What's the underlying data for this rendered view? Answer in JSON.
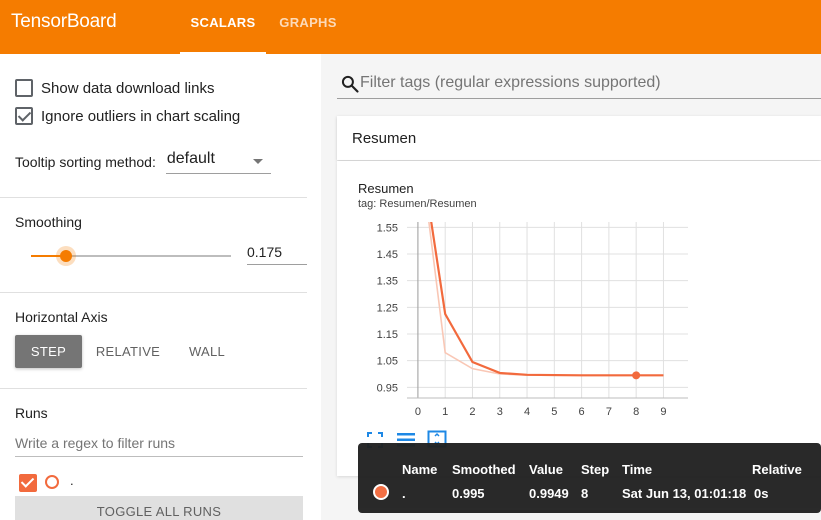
{
  "app": {
    "title": "TensorBoard",
    "accent": "#f57c00",
    "tabs": [
      {
        "label": "SCALARS",
        "active": true
      },
      {
        "label": "GRAPHS",
        "active": false
      }
    ]
  },
  "sidebar": {
    "show_download_links": {
      "label": "Show data download links",
      "checked": false
    },
    "ignore_outliers": {
      "label": "Ignore outliers in chart scaling",
      "checked": true
    },
    "tooltip_sorting": {
      "label": "Tooltip sorting method:",
      "value": "default"
    },
    "smoothing": {
      "title": "Smoothing",
      "value": "0.175",
      "fraction": 0.175
    },
    "horizontal_axis": {
      "title": "Horizontal Axis",
      "options": [
        "STEP",
        "RELATIVE",
        "WALL"
      ],
      "selected": "STEP"
    },
    "runs": {
      "title": "Runs",
      "filter_placeholder": "Write a regex to filter runs",
      "items": [
        {
          "name": ".",
          "checked": true,
          "color": "#f26a3d"
        }
      ],
      "toggle_label": "TOGGLE ALL RUNS"
    }
  },
  "main": {
    "filter_placeholder": "Filter tags (regular expressions supported)",
    "pane_title": "Resumen",
    "card": {
      "title": "Resumen",
      "tag": "tag: Resumen/Resumen"
    },
    "icons": [
      "fullscreen-icon",
      "list-icon",
      "fit-domain-icon",
      "search-icon"
    ]
  },
  "tooltip": {
    "headers": [
      "Name",
      "Smoothed",
      "Value",
      "Step",
      "Time",
      "Relative"
    ],
    "row": {
      "name": ".",
      "smoothed": "0.995",
      "value": "0.9949",
      "step": "8",
      "time": "Sat Jun 13, 01:01:18",
      "relative": "0s",
      "color": "#f26a3d"
    }
  },
  "chart_data": {
    "type": "line",
    "title": "Resumen",
    "x": [
      0,
      1,
      2,
      3,
      4,
      5,
      6,
      7,
      8,
      9
    ],
    "x_ticks": [
      "0",
      "1",
      "2",
      "3",
      "4",
      "5",
      "6",
      "7",
      "8",
      "9"
    ],
    "y_ticks": [
      "0.95",
      "1.05",
      "1.15",
      "1.25",
      "1.35",
      "1.45",
      "1.55"
    ],
    "ylim": [
      0.91,
      1.57
    ],
    "xlim": [
      -0.4,
      9.9
    ],
    "grid": true,
    "series": [
      {
        "name": ".",
        "kind": "raw",
        "color": "#f9c7b5",
        "values": [
          1.9,
          1.08,
          1.02,
          1.0,
          0.996,
          0.995,
          0.995,
          0.995,
          0.995,
          0.995
        ]
      },
      {
        "name": ".",
        "kind": "smoothed",
        "color": "#f26a3d",
        "values": [
          1.9,
          1.225,
          1.045,
          1.004,
          0.997,
          0.996,
          0.995,
          0.995,
          0.995,
          0.995
        ]
      }
    ],
    "highlight": {
      "x": 8,
      "y": 0.995
    }
  }
}
